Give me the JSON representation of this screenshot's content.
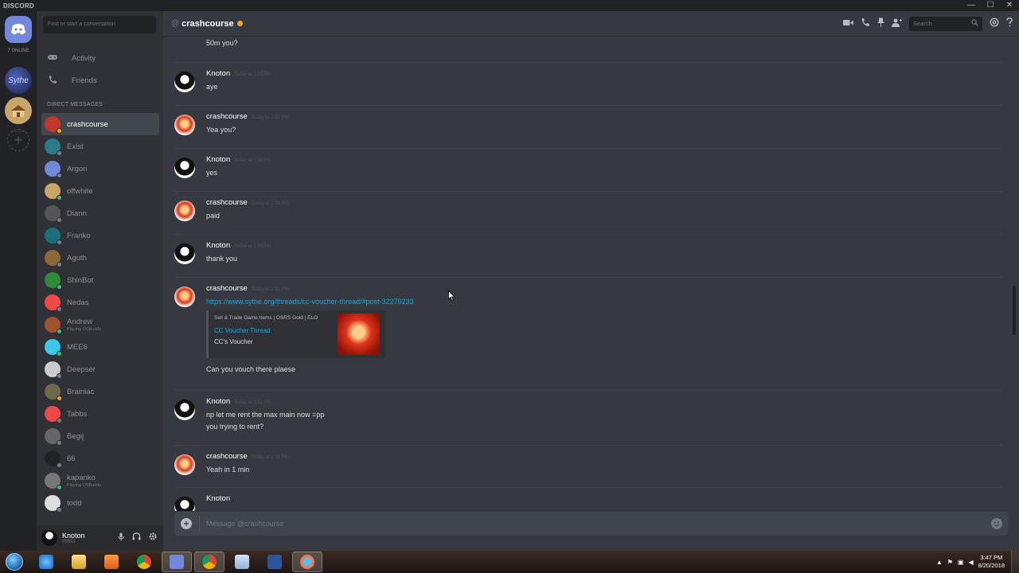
{
  "app": {
    "brand": "DISCORD"
  },
  "window_controls": {
    "minimize": "—",
    "maximize": "☐",
    "close": "✕"
  },
  "guilds": {
    "online_count": "7 ONLINE",
    "sythe_label": "Sythe",
    "add_symbol": "+"
  },
  "sidebar": {
    "search_placeholder": "Find or start a conversation",
    "activity_label": "Activity",
    "friends_label": "Friends",
    "dm_header": "DIRECT MESSAGES",
    "dms": [
      {
        "name": "crashcourse",
        "status": "#faa61a",
        "avatar": "#c0392b",
        "active": true
      },
      {
        "name": "Exist",
        "status": "#747f8d",
        "avatar": "#2a7c8a"
      },
      {
        "name": "Argon",
        "status": "#747f8d",
        "avatar": "#7289da"
      },
      {
        "name": "offwhite",
        "status": "#43b581",
        "avatar": "#c9a56a"
      },
      {
        "name": "Diann",
        "status": "#747f8d",
        "avatar": "#555"
      },
      {
        "name": "Franko",
        "status": "#747f8d",
        "avatar": "#1a6f7a"
      },
      {
        "name": "Aguth",
        "status": "#747f8d",
        "avatar": "#8a6a3a"
      },
      {
        "name": "ShinBot",
        "status": "#43b581",
        "avatar": "#2e8b3a"
      },
      {
        "name": "Nedas",
        "status": "#747f8d",
        "avatar": "#f04747"
      },
      {
        "name": "Andrew",
        "status": "#43b581",
        "avatar": "#a0522d",
        "sub": "Playing OSBuddy"
      },
      {
        "name": "MEE6",
        "status": "#43b581",
        "avatar": "#3ec7e8"
      },
      {
        "name": "Deepser",
        "status": "#747f8d",
        "avatar": "#ccc"
      },
      {
        "name": "Brainiac",
        "status": "#faa61a",
        "avatar": "#6b6b4a"
      },
      {
        "name": "Tabbs",
        "status": "#747f8d",
        "avatar": "#f04747"
      },
      {
        "name": "Begij",
        "status": "#747f8d",
        "avatar": "#666"
      },
      {
        "name": "66",
        "status": "#747f8d",
        "avatar": "#222"
      },
      {
        "name": "kapanko",
        "status": "#43b581",
        "avatar": "#777",
        "sub": "Playing OSBuddy"
      },
      {
        "name": "todd",
        "status": "#747f8d",
        "avatar": "#ddd"
      }
    ]
  },
  "user": {
    "name": "Knoton",
    "tag": "#9551"
  },
  "chat": {
    "at_symbol": "@",
    "title": "crashcourse",
    "search_placeholder": "Search",
    "composer_placeholder": "Message @crashcourse",
    "messages": [
      {
        "author": "",
        "time": "",
        "lines": [
          "50m you?"
        ]
      },
      {
        "author": "Knoton",
        "time": "Today at 1:50 PM",
        "lines": [
          "aye"
        ]
      },
      {
        "author": "crashcourse",
        "time": "Today at 1:50 PM",
        "lines": [
          "Yea you?"
        ]
      },
      {
        "author": "Knoton",
        "time": "Today at 1:50 PM",
        "lines": [
          "yes"
        ]
      },
      {
        "author": "crashcourse",
        "time": "Today at 1:50 PM",
        "lines": [
          "paid"
        ]
      },
      {
        "author": "Knoton",
        "time": "Today at 1:50 PM",
        "lines": [
          "thank you"
        ]
      },
      {
        "author": "crashcourse",
        "time": "Today at 1:51 PM",
        "link": "https://www.sythe.org/threads/cc-voucher-thread/#post-32270233",
        "embed": {
          "provider": "Sell & Trade Game Items | OSRS Gold | ELO",
          "title": "CC Voucher Thread",
          "description": "CC's Voucher"
        },
        "after": "Can you vouch there plaese"
      },
      {
        "author": "Knoton",
        "time": "Today at 1:51 PM",
        "lines": [
          "np let me rent the max main now =pp",
          "you trying to rent?"
        ]
      },
      {
        "author": "crashcourse",
        "time": "Today at 1:56 PM",
        "lines": [
          "Yeah in 1 min"
        ]
      },
      {
        "author": "Knoton",
        "time": "",
        "lines": []
      }
    ]
  },
  "taskbar": {
    "time": "3:47 PM",
    "date": "8/20/2018"
  }
}
